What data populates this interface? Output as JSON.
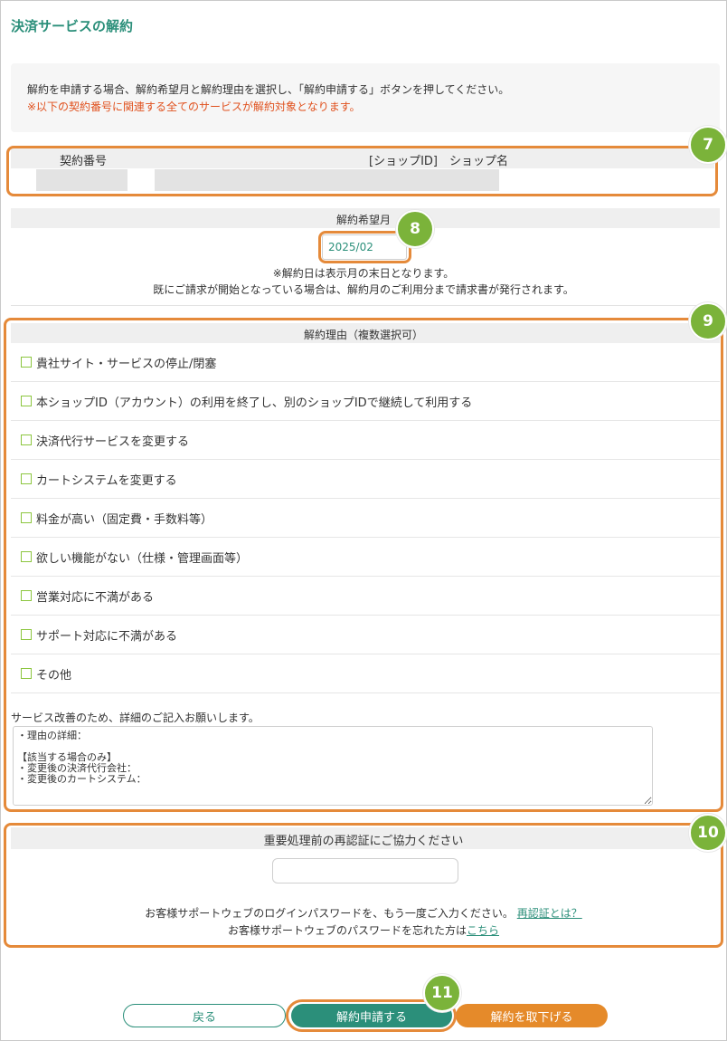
{
  "page": {
    "title": "決済サービスの解約"
  },
  "notice": {
    "line1": "解約を申請する場合、解約希望月と解約理由を選択し、「解約申請する」ボタンを押してください。",
    "line2": "※以下の契約番号に関連する全てのサービスが解約対象となります。"
  },
  "contract_table": {
    "col_contract_no": "契約番号",
    "col_shop": "[ショップID]　ショップ名"
  },
  "month": {
    "header": "解約希望月",
    "value": "2025/02",
    "note1": "※解約日は表示月の末日となります。",
    "note2": "既にご請求が開始となっている場合は、解約月のご利用分まで請求書が発行されます。"
  },
  "reasons": {
    "header": "解約理由（複数選択可）",
    "items": [
      "貴社サイト・サービスの停止/閉塞",
      "本ショップID（アカウント）の利用を終了し、別のショップIDで継続して利用する",
      "決済代行サービスを変更する",
      "カートシステムを変更する",
      "料金が高い（固定費・手数料等）",
      "欲しい機能がない（仕様・管理画面等）",
      "営業対応に不満がある",
      "サポート対応に不満がある",
      "その他"
    ],
    "detail_prompt": "サービス改善のため、詳細のご記入お願いします。",
    "detail_text": "・理由の詳細：\n\n【該当する場合のみ】\n・変更後の決済代行会社：\n・変更後のカートシステム："
  },
  "reauth": {
    "header": "重要処理前の再認証にご協力ください",
    "password_value": "",
    "line1": "お客様サポートウェブのログインパスワードを、もう一度ご入力ください。",
    "line1_link": "再認証とは？",
    "line2": "お客様サポートウェブのパスワードを忘れた方は",
    "line2_link": "こちら"
  },
  "buttons": {
    "back": "戻る",
    "apply": "解約申請する",
    "withdraw": "解約を取下げる"
  },
  "badges": {
    "contract": "7",
    "month": "8",
    "reasons": "9",
    "reauth": "10",
    "apply": "11"
  },
  "colors": {
    "accent": "#2b8f7a",
    "highlight": "#e58a3a",
    "badge": "#7bb33a",
    "warning": "#e0511e"
  }
}
